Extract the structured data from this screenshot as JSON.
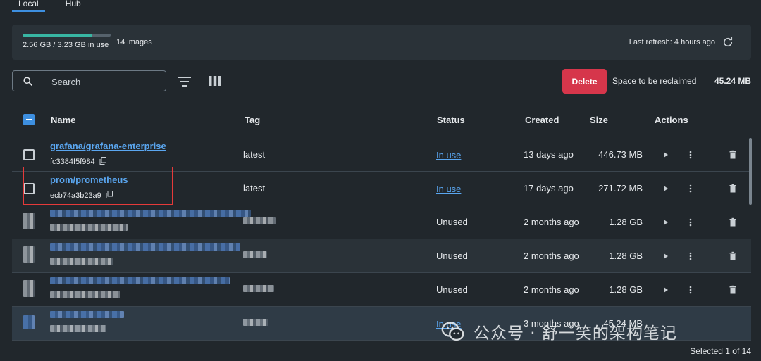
{
  "tabs": [
    {
      "label": "Local",
      "active": true
    },
    {
      "label": "Hub",
      "active": false
    }
  ],
  "summary": {
    "usage_fraction": 0.79,
    "usage_text": "2.56 GB / 3.23 GB in use",
    "images_count": "14 images",
    "last_refresh": "Last refresh: 4 hours ago"
  },
  "toolbar": {
    "search_placeholder": "Search",
    "delete_label": "Delete",
    "reclaim_label": "Space to be reclaimed",
    "reclaim_value": "45.24 MB"
  },
  "table": {
    "columns": {
      "name": "Name",
      "tag": "Tag",
      "status": "Status",
      "created": "Created",
      "size": "Size",
      "actions": "Actions"
    },
    "rows": [
      {
        "name": "grafana/grafana-enterprise",
        "id": "fc3384f5f984",
        "tag": "latest",
        "status": "In use",
        "created": "13 days ago",
        "size": "446.73 MB"
      },
      {
        "name": "prom/prometheus",
        "id": "ecb74a3b23a9",
        "tag": "latest",
        "status": "In use",
        "created": "17 days ago",
        "size": "271.72 MB"
      },
      {
        "status": "Unused",
        "created": "2 months ago",
        "size": "1.28 GB"
      },
      {
        "status": "Unused",
        "created": "2 months ago",
        "size": "1.28 GB"
      },
      {
        "status": "Unused",
        "created": "2 months ago",
        "size": "1.28 GB"
      },
      {
        "status": "In use",
        "created": "3 months ago",
        "size": "45.24 MB"
      }
    ]
  },
  "watermark": {
    "text": "公众号 · 舒一笑的架构笔记"
  },
  "footer": {
    "selected": "Selected 1 of 14"
  },
  "colors": {
    "accent": "#3d8fe0",
    "danger": "#d6364b",
    "link": "#5aa6f0",
    "usage": "#38b6a3"
  }
}
